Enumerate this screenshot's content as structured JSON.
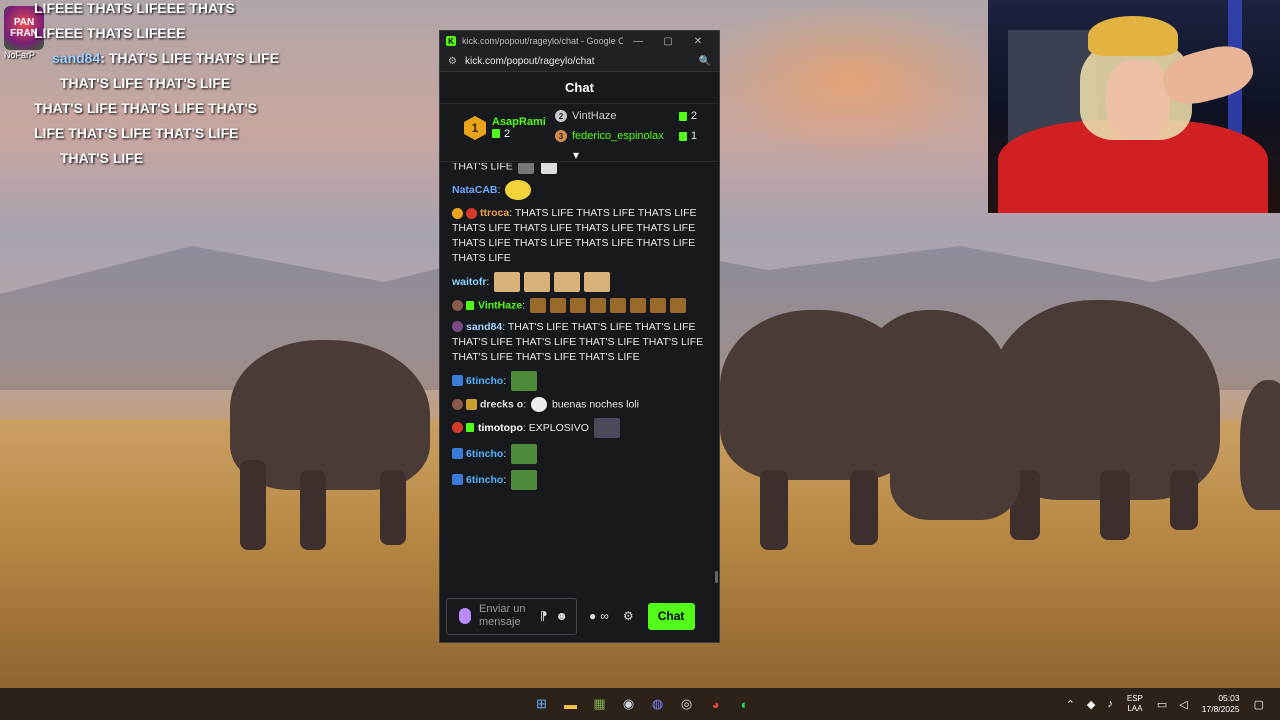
{
  "overlay_chat": {
    "lines": [
      {
        "user": "",
        "text": "LIFEEE  THATS LIFEEE  THATS"
      },
      {
        "user": "",
        "text": "LIFEEE  THATS LIFEEE"
      },
      {
        "user": "sand84",
        "text": "THAT'S LIFE  THAT'S LIFE"
      },
      {
        "user": "",
        "text": "THAT'S LIFE  THAT'S LIFE"
      },
      {
        "user": "",
        "text": "THAT'S LIFE  THAT'S LIFE  THAT'S"
      },
      {
        "user": "",
        "text": "LIFE  THAT'S LIFE  THAT'S LIFE"
      },
      {
        "user": "",
        "text": "THAT'S LIFE"
      }
    ],
    "logo_text": "PAN FRAN",
    "tag": "NoFarP"
  },
  "window": {
    "title": "kick.com/popout/rageylo/chat - Google Chrome",
    "url": "kick.com/popout/rageylo/chat",
    "chat_header": "Chat"
  },
  "leaderboard": {
    "first": {
      "rank": "1",
      "name": "AsapRami",
      "count": "2"
    },
    "others": [
      {
        "rank": "2",
        "name": "VintHaze",
        "count": "2",
        "color": "#c9c9c9"
      },
      {
        "rank": "3",
        "name": "federico_espinolax",
        "count": "1",
        "color": "#d68a4a"
      }
    ]
  },
  "messages": [
    {
      "user": "",
      "color": "#ffffff",
      "text": "THAT'S LIFE"
    },
    {
      "user": "NataCAB",
      "color": "#6fa8ff",
      "text": ""
    },
    {
      "user": "ttroca",
      "color": "#f0a04b",
      "text": "THATS LIFE  THATS LIFE  THATS LIFE  THATS LIFE  THATS LIFE  THATS LIFE  THATS LIFE  THATS LIFE  THATS LIFE  THATS LIFE  THATS LIFE  THATS LIFE"
    },
    {
      "user": "waitofr",
      "color": "#8ad4ff",
      "text": ""
    },
    {
      "user": "VintHaze",
      "color": "#53fc18",
      "text": ""
    },
    {
      "user": "sand84",
      "color": "#9fd3ff",
      "text": "THAT'S LIFE  THAT'S LIFE  THAT'S LIFE  THAT'S LIFE  THAT'S LIFE  THAT'S LIFE  THAT'S LIFE  THAT'S LIFE  THAT'S LIFE  THAT'S LIFE"
    },
    {
      "user": "6tincho",
      "color": "#4fb3ff",
      "text": ""
    },
    {
      "user": "drecks o",
      "color": "#e2e2e2",
      "text": "buenas noches loli"
    },
    {
      "user": "timotopo",
      "color": "#ffffff",
      "text": "EXPLOSIVO"
    },
    {
      "user": "6tincho",
      "color": "#4fb3ff",
      "text": ""
    },
    {
      "user": "6tincho",
      "color": "#4fb3ff",
      "text": ""
    }
  ],
  "composer": {
    "placeholder": "Enviar un mensaje",
    "send_label": "Chat"
  },
  "taskbar": {
    "lang_top": "ESP",
    "lang_bottom": "LAA",
    "time": "05:03",
    "date": "17/8/2025"
  },
  "colors": {
    "kick_green": "#53fc18",
    "window_bg": "#18191c"
  }
}
